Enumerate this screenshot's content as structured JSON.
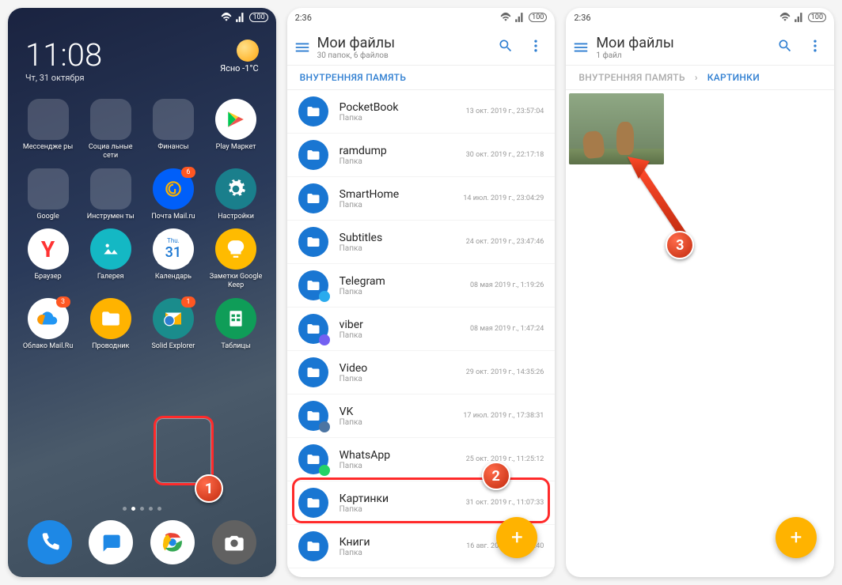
{
  "screen1": {
    "time": "11:08",
    "date": "Чт, 31 октября",
    "weather": "Ясно -1°C",
    "apps": [
      {
        "label": "Мессендже\nры",
        "type": "folder",
        "colors": [
          "#25d366",
          "#7b68ee",
          "#34b7f1",
          "#e1306c"
        ]
      },
      {
        "label": "Социа\nльные сети",
        "type": "folder",
        "colors": [
          "#4c75a3",
          "#ff8800",
          "#ff0050",
          "#4c75a3"
        ]
      },
      {
        "label": "Финансы",
        "type": "folder",
        "colors": [
          "#003087",
          "#ffc439",
          "#fff",
          "#003087"
        ]
      },
      {
        "label": "Play Маркет",
        "bg": "#fff",
        "icon": "play"
      },
      {
        "label": "Google",
        "type": "folder",
        "colors": [
          "#4285f4",
          "#ea4335",
          "#fbbc05",
          "#34a853"
        ]
      },
      {
        "label": "Инструмен\nты",
        "type": "folder",
        "colors": [
          "#00bcd4",
          "#ff9800",
          "#9c27b0",
          "#607d8b"
        ]
      },
      {
        "label": "Почта\nMail.ru",
        "bg": "#005ff9",
        "icon": "mail",
        "badge": "6"
      },
      {
        "label": "Настройки",
        "bg": "#1a7f8c",
        "icon": "gear"
      },
      {
        "label": "Браузер",
        "bg": "#fff",
        "icon": "yandex"
      },
      {
        "label": "Галерея",
        "bg": "#14b8c4",
        "icon": "gallery"
      },
      {
        "label": "Календарь",
        "bg": "#fff",
        "icon": "calendar",
        "cal": "31",
        "calday": "Thu."
      },
      {
        "label": "Заметки\nGoogle Keep",
        "bg": "#ffbb00",
        "icon": "keep"
      },
      {
        "label": "Облако\nMail.Ru",
        "bg": "#fff",
        "icon": "cloud",
        "badge": "3"
      },
      {
        "label": "Проводник",
        "bg": "#ffb300",
        "icon": "folder"
      },
      {
        "label": "Solid\nExplorer",
        "bg": "#1a8c8c",
        "icon": "solid",
        "badge": "1"
      },
      {
        "label": "Таблицы",
        "bg": "#0f9d58",
        "icon": "sheets"
      }
    ],
    "dock": [
      {
        "bg": "#1e88e5",
        "icon": "phone"
      },
      {
        "bg": "#fff",
        "icon": "messages"
      },
      {
        "bg": "#fff",
        "icon": "chrome"
      },
      {
        "bg": "#616161",
        "icon": "camera"
      }
    ]
  },
  "screen2": {
    "time": "2:36",
    "title": "Мои файлы",
    "sub": "30 папок, 6 файлов",
    "breadcrumb": [
      "ВНУТРЕННЯЯ ПАМЯТЬ"
    ],
    "folders": [
      {
        "name": "PocketBook",
        "type": "Папка",
        "date": "13 окт. 2019 г., 23:57:04"
      },
      {
        "name": "ramdump",
        "type": "Папка",
        "date": "30 окт. 2019 г., 22:17:18"
      },
      {
        "name": "SmartHome",
        "type": "Папка",
        "date": "14 июл. 2019 г., 23:04:29"
      },
      {
        "name": "Subtitles",
        "type": "Папка",
        "date": "24 окт. 2019 г., 23:47:46"
      },
      {
        "name": "Telegram",
        "type": "Папка",
        "date": "08 мая 2019 г., 1:19:26",
        "corner": "#2aabee"
      },
      {
        "name": "viber",
        "type": "Папка",
        "date": "08 мая 2019 г., 1:47:24",
        "corner": "#7360f2"
      },
      {
        "name": "Video",
        "type": "Папка",
        "date": "29 окт. 2019 г., 14:35:26"
      },
      {
        "name": "VK",
        "type": "Папка",
        "date": "17 июл. 2019 г., 17:38:31",
        "corner": "#4c75a3"
      },
      {
        "name": "WhatsApp",
        "type": "Папка",
        "date": "25 окт. 2019 г., 11:25:12",
        "corner": "#25d366"
      },
      {
        "name": "Картинки",
        "type": "Папка",
        "date": "31 окт. 2019 г., 11:07:33"
      },
      {
        "name": "Книги",
        "type": "Папка",
        "date": "16 авг. 2019 г., 14:28:40"
      }
    ]
  },
  "screen3": {
    "time": "2:36",
    "title": "Мои файлы",
    "sub": "1 файл",
    "breadcrumb": [
      "ВНУТРЕННЯЯ ПАМЯТЬ",
      "КАРТИНКИ"
    ]
  },
  "steps": {
    "s1": "1",
    "s2": "2",
    "s3": "3"
  }
}
